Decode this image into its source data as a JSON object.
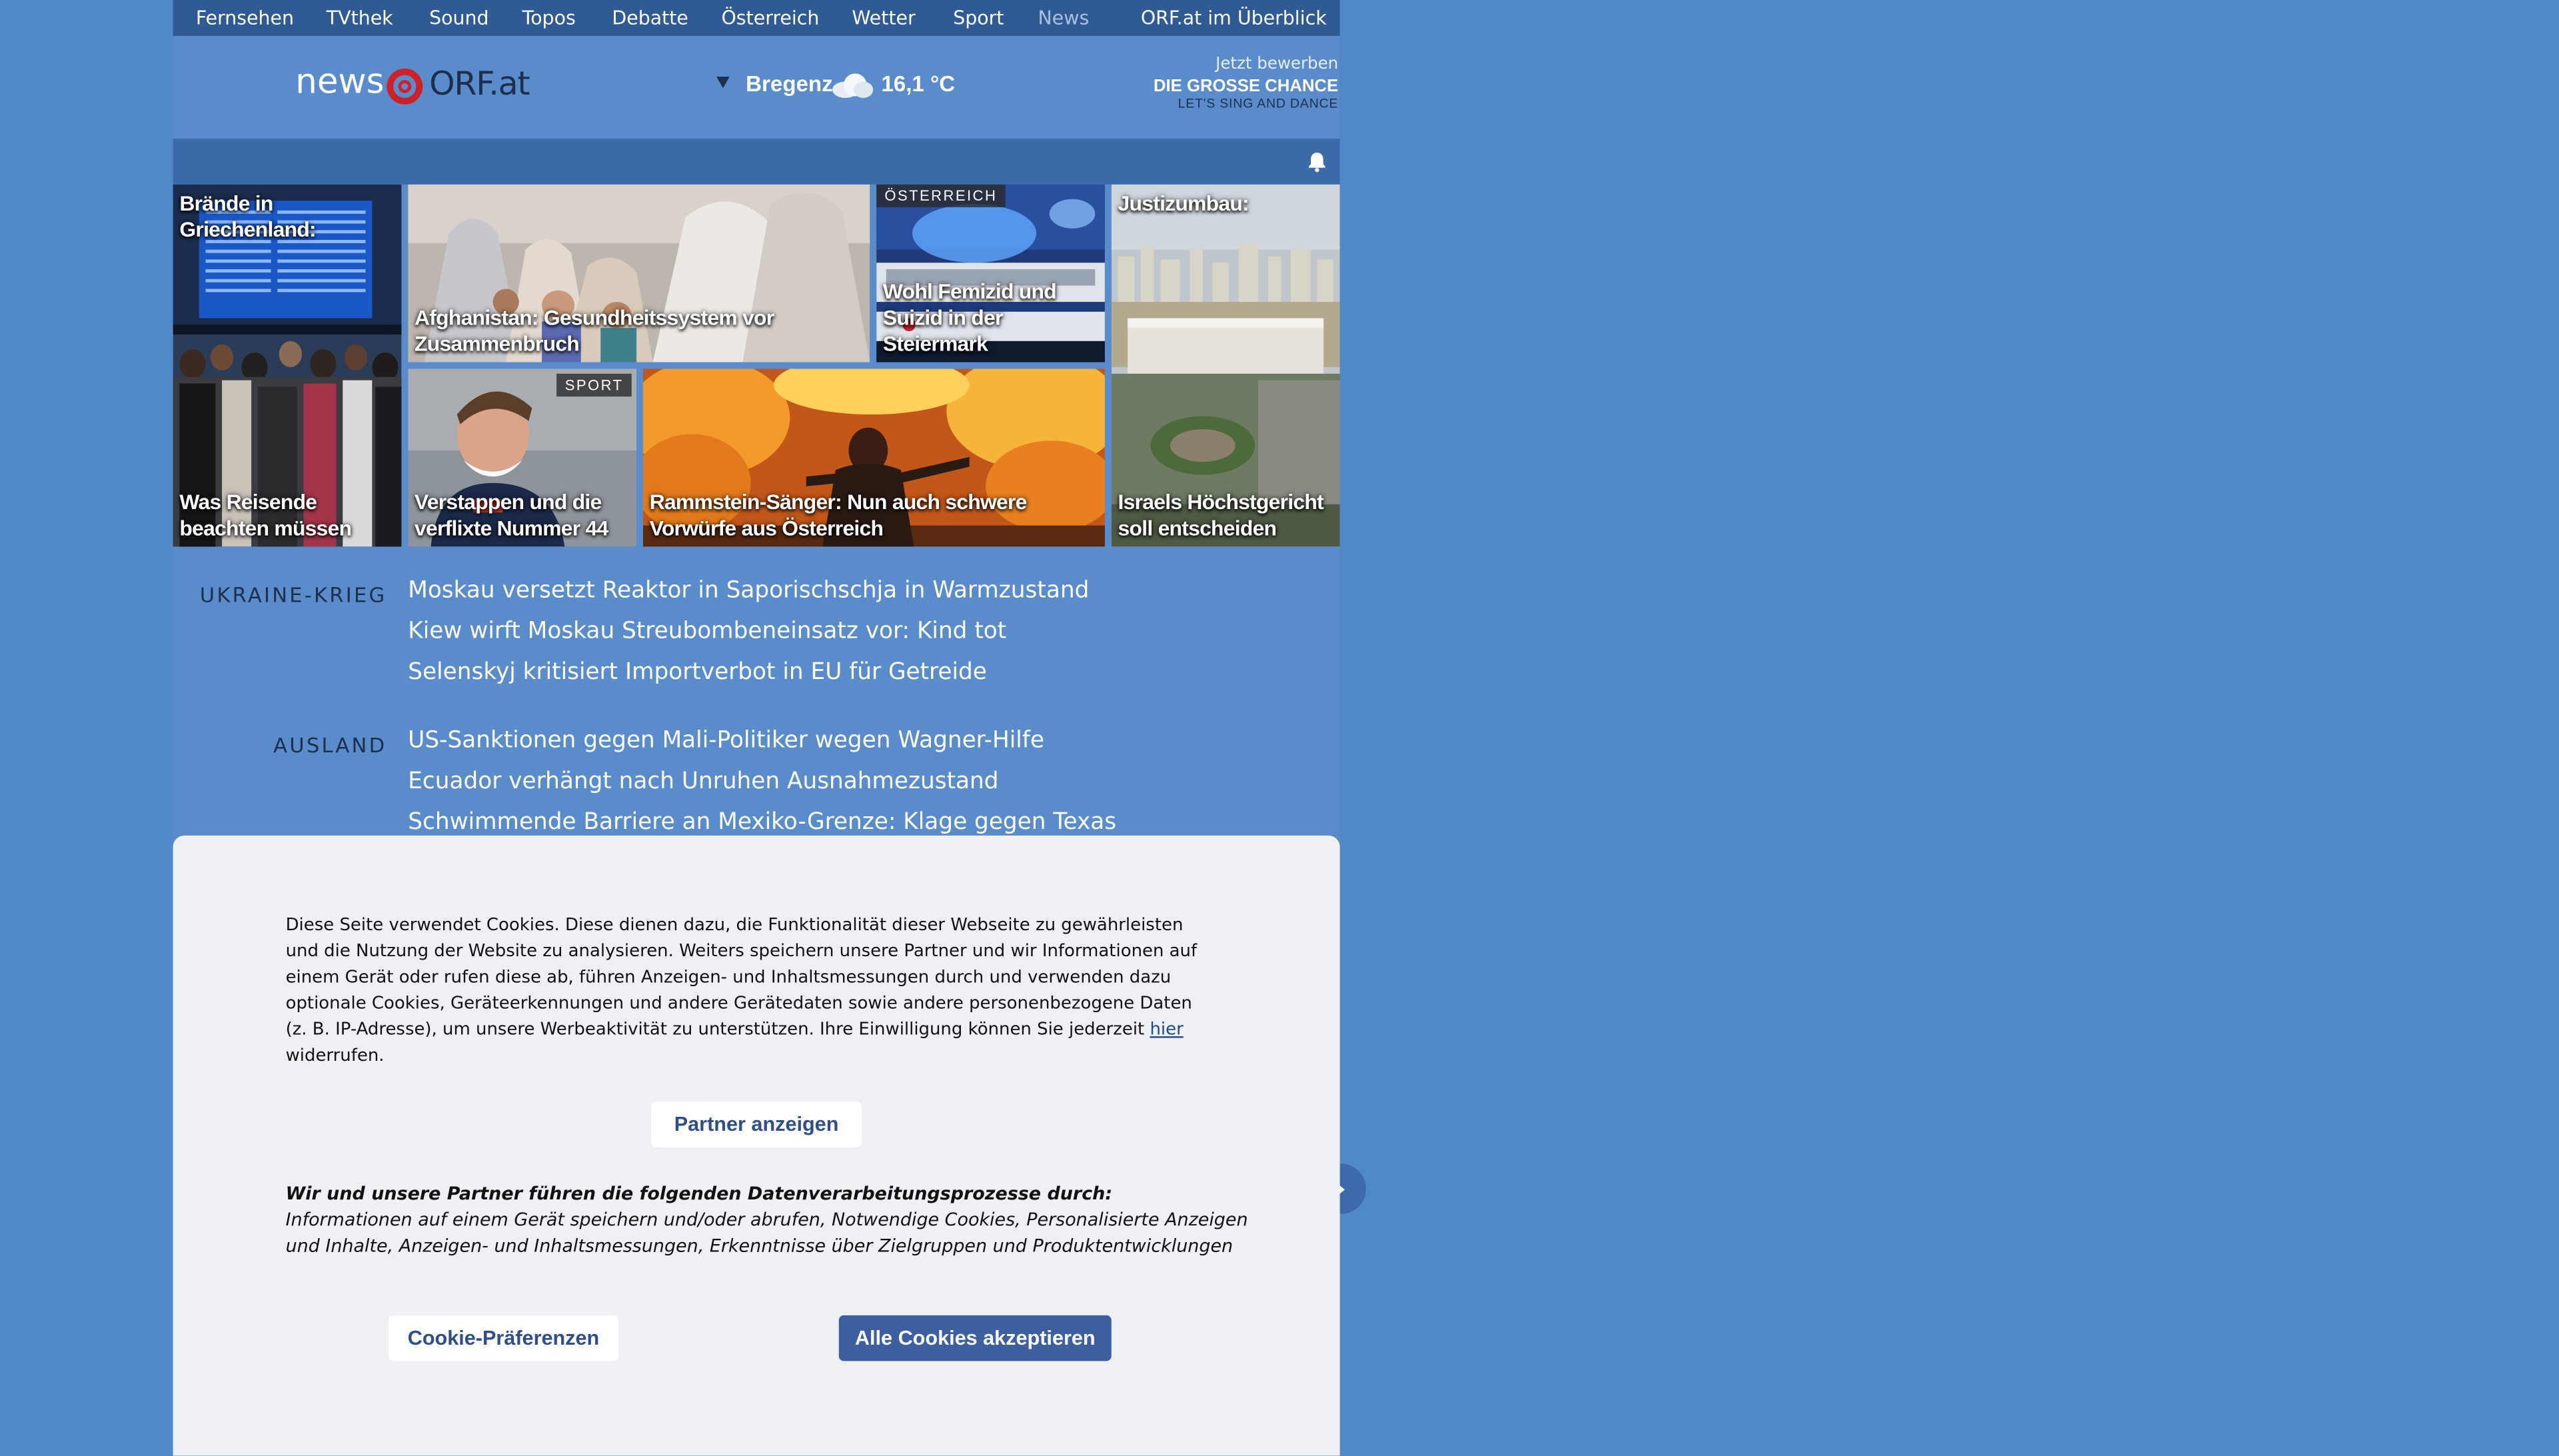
{
  "nav": {
    "items": [
      "Fernsehen",
      "TVthek",
      "Sound",
      "Topos",
      "Debatte",
      "Österreich",
      "Wetter",
      "Sport",
      "News"
    ],
    "active": "News",
    "overview": "ORF.at im Überblick"
  },
  "header": {
    "logo_news": "news",
    "logo_orf": "ORF.at",
    "weather_city": "Bregenz",
    "weather_icon": "cloud-icon",
    "weather_temp": "16,1 °C",
    "promo_line1": "Jetzt bewerben",
    "promo_line2": "DIE GROSSE CHANCE",
    "promo_line3": "LET'S SING AND DANCE"
  },
  "tiles": [
    {
      "top": "Brände in Griechenland:",
      "bottom": "Was Reisende beachten müssen"
    },
    {
      "caption": "Afghanistan: Gesundheitssystem vor Zusammenbruch"
    },
    {
      "tag": "ÖSTERREICH",
      "caption": "Wohl Femizid und Suizid in der Steiermark"
    },
    {
      "top": "Justizumbau:",
      "bottom": "Israels Höchstgericht soll entscheiden"
    },
    {
      "tag": "SPORT",
      "caption": "Verstappen und die verflixte Nummer 44"
    },
    {
      "caption": "Rammstein-Sänger: Nun auch schwere Vorwürfe aus Österreich"
    }
  ],
  "sections": [
    {
      "label": "UKRAINE-KRIEG",
      "headlines": [
        "Moskau versetzt Reaktor in Saporischschja in Warmzustand",
        "Kiew wirft Moskau Streubombeneinsatz vor: Kind tot",
        "Selenskyj kritisiert Importverbot in EU für Getreide"
      ]
    },
    {
      "label": "AUSLAND",
      "headlines": [
        "US-Sanktionen gegen Mali-Politiker wegen Wagner-Hilfe",
        "Ecuador verhängt nach Unruhen Ausnahmezustand",
        "Schwimmende Barriere an Mexiko-Grenze: Klage gegen Texas"
      ]
    }
  ],
  "cookie": {
    "text_before_link": "Diese Seite verwendet Cookies. Diese dienen dazu, die Funktionalität dieser Webseite zu gewährleisten und die Nutzung der Website zu analysieren. Weiters speichern unsere Partner und wir Informationen auf einem Gerät oder rufen diese ab, führen Anzeigen- und Inhaltsmessungen durch und verwenden dazu optionale Cookies, Geräteerkennungen und andere Gerätedaten sowie andere personenbezogene Daten (z. B. IP-Adresse), um unsere Werbeaktivität zu unterstützen. Ihre Einwilligung können Sie jederzeit ",
    "link": "hier",
    "text_after_link": " widerrufen.",
    "partner_button": "Partner anzeigen",
    "purpose_title": "Wir und unsere Partner führen die folgenden Datenverarbeitungsprozesse durch:",
    "purpose_text": "Informationen auf einem Gerät speichern und/oder abrufen, Notwendige Cookies, Personalisierte Anzeigen und Inhalte, Anzeigen- und Inhaltsmessungen, Erkenntnisse über Zielgruppen und Produktentwicklungen",
    "pref_button": "Cookie-Präferenzen",
    "accept_button": "Alle Cookies akzeptieren"
  }
}
